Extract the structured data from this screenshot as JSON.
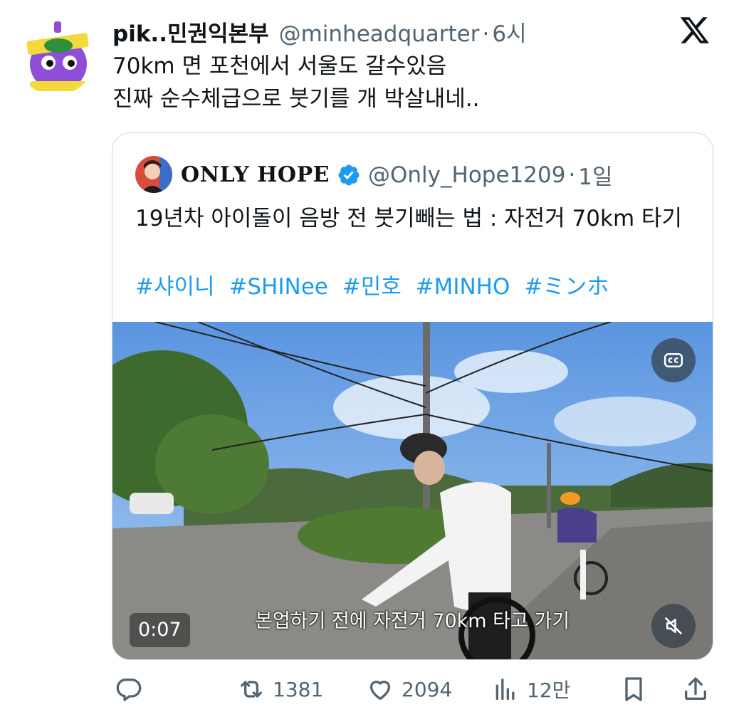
{
  "tweet": {
    "author_name": "pik..민권익본부",
    "author_handle": "@minheadquarter",
    "time": "6시",
    "lines": [
      "70km 면 포천에서 서울도 갈수있음",
      "진짜 순수체급으로 붓기를 개 박살내네.."
    ]
  },
  "quote": {
    "author_name": "ONLY HOPE",
    "author_handle": "@Only_Hope1209",
    "time": "1일",
    "text": "19년차 아이돌이 음방 전 붓기빼는 법 : 자전거 70km 타기",
    "hashtags": [
      "#샤이니",
      "#SHINee",
      "#민호",
      "#MINHO",
      "#ミンホ"
    ]
  },
  "video": {
    "timer": "0:07",
    "subtitle": "본업하기 전에 자전거 70km 타고 가기",
    "cc_icon": "closed-captions-icon",
    "mute_icon": "muted-speaker-icon"
  },
  "actions": {
    "reply": "",
    "retweets": "1381",
    "likes": "2094",
    "views": "12만"
  },
  "colors": {
    "text": "#0f1419",
    "secondary": "#536471",
    "link": "#1d9bf0",
    "verified": "#1d9bf0",
    "border": "#cfd9de"
  }
}
